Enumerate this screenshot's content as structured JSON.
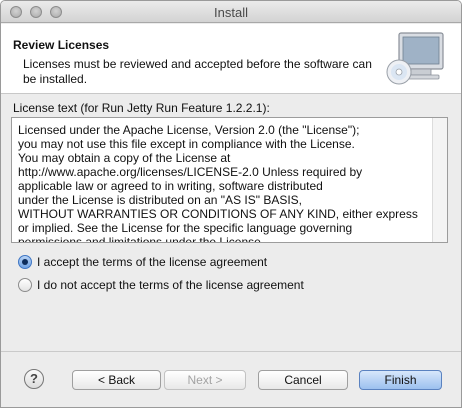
{
  "window": {
    "title": "Install"
  },
  "header": {
    "title": "Review Licenses",
    "description": "Licenses must be reviewed and accepted before the software can be installed."
  },
  "license": {
    "label": "License text (for Run Jetty Run Feature 1.2.2.1):",
    "text": "Licensed under the Apache License, Version 2.0 (the \"License\");\nyou may not use this file except in compliance with the License.\nYou may obtain a copy of the License at\nhttp://www.apache.org/licenses/LICENSE-2.0 Unless required by\napplicable law or agreed to in writing, software distributed\nunder the License is distributed on an \"AS IS\" BASIS,\nWITHOUT WARRANTIES OR CONDITIONS OF ANY KIND, either express\nor implied. See the License for the specific language governing\npermissions and limitations under the License."
  },
  "options": {
    "accept": {
      "label": "I accept the terms of the license agreement",
      "selected": true
    },
    "decline": {
      "label": "I do not accept the terms of the license agreement",
      "selected": false
    }
  },
  "buttons": {
    "help": "?",
    "back": "< Back",
    "next": "Next >",
    "cancel": "Cancel",
    "finish": "Finish"
  },
  "colors": {
    "accent": "#6ea1e4",
    "default_button": "#9cc0ef"
  }
}
